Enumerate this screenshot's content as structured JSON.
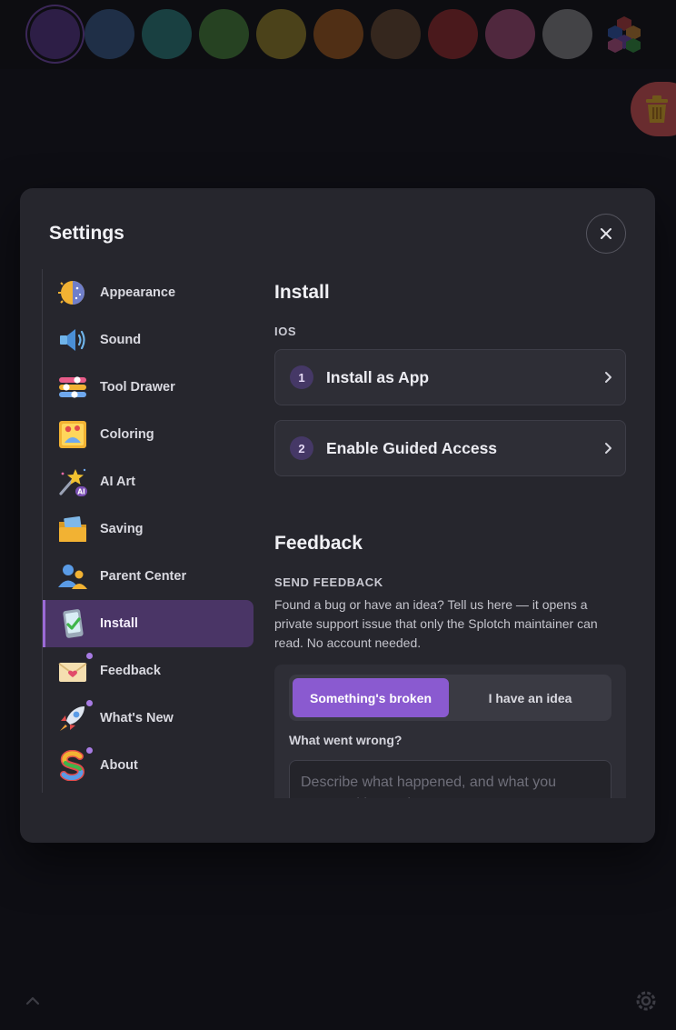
{
  "colors": {
    "swatches": [
      "#5b3b8c",
      "#3c5f8e",
      "#2f8580",
      "#4d8a3c",
      "#9d8a2a",
      "#a8601f",
      "#6d4e33",
      "#9c2f2f",
      "#a8507b",
      "#8c8c8c"
    ],
    "accent": "#8a5ad0",
    "danger": "#e05a5a"
  },
  "toolbar": {
    "selected_swatch_index": 0,
    "picker_icon": "hex-palette-icon",
    "trash_icon": "trash-icon"
  },
  "modal": {
    "title": "Settings",
    "close_icon": "close-icon"
  },
  "sidebar": {
    "items": [
      {
        "label": "Appearance",
        "icon": "appearance-icon"
      },
      {
        "label": "Sound",
        "icon": "speaker-icon"
      },
      {
        "label": "Tool Drawer",
        "icon": "sliders-icon"
      },
      {
        "label": "Coloring",
        "icon": "picture-icon"
      },
      {
        "label": "AI Art",
        "icon": "magic-wand-icon"
      },
      {
        "label": "Saving",
        "icon": "folder-icon"
      },
      {
        "label": "Parent Center",
        "icon": "people-icon"
      },
      {
        "label": "Install",
        "icon": "phone-check-icon",
        "active": true
      },
      {
        "label": "Feedback",
        "icon": "envelope-icon",
        "dot": true
      },
      {
        "label": "What's New",
        "icon": "rocket-icon",
        "dot": true
      },
      {
        "label": "About",
        "icon": "splotch-s-icon",
        "dot": true
      }
    ]
  },
  "install": {
    "title": "Install",
    "platform": "IOS",
    "steps": [
      {
        "num": "1",
        "label": "Install as App"
      },
      {
        "num": "2",
        "label": "Enable Guided Access"
      }
    ]
  },
  "feedback": {
    "title": "Feedback",
    "subhead": "SEND FEEDBACK",
    "description": "Found a bug or have an idea? Tell us here — it opens a private support issue that only the Splotch maintainer can read. No account needed.",
    "options": [
      "Something's broken",
      "I have an idea"
    ],
    "selected_option": 0,
    "field_label": "What went wrong?",
    "placeholder": "Describe what happened, and what you expected instead"
  },
  "footer": {
    "collapse_icon": "chevron-up-icon",
    "settings_icon": "gear-icon"
  }
}
